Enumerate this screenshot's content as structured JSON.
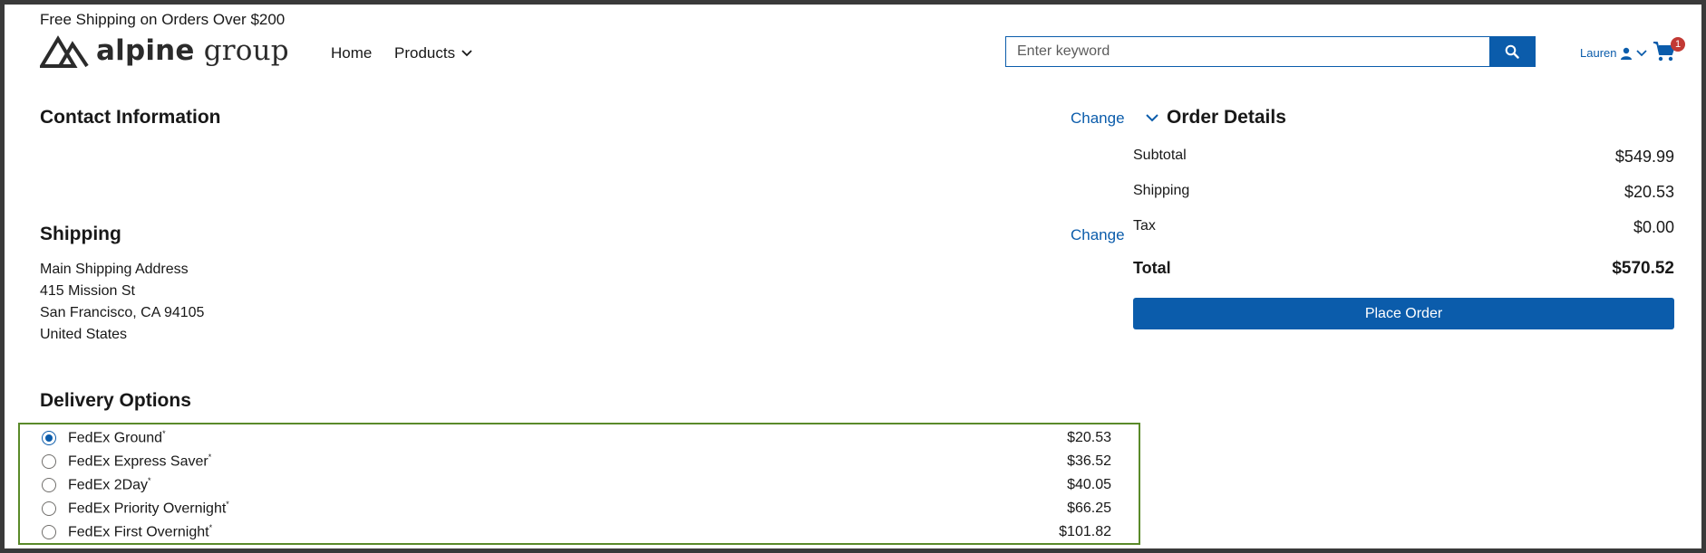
{
  "header": {
    "promo": "Free Shipping on Orders Over $200",
    "logo": {
      "bold": "alpine",
      "light": " group"
    },
    "nav": {
      "home": "Home",
      "products": "Products"
    },
    "search": {
      "placeholder": "Enter keyword",
      "value": ""
    },
    "user": {
      "name": "Lauren"
    },
    "cart": {
      "count": "1"
    }
  },
  "contact": {
    "title": "Contact Information",
    "change": "Change"
  },
  "shipping": {
    "title": "Shipping",
    "change": "Change",
    "address": [
      "Main Shipping Address",
      "415 Mission St",
      "San Francisco, CA 94105",
      "United States"
    ]
  },
  "delivery": {
    "title": "Delivery Options",
    "selected_index": 0,
    "options": [
      {
        "label": "FedEx Ground",
        "mark": "*",
        "price": "$20.53"
      },
      {
        "label": "FedEx Express Saver",
        "mark": "*",
        "price": "$36.52"
      },
      {
        "label": "FedEx 2Day",
        "mark": "*",
        "price": "$40.05"
      },
      {
        "label": "FedEx Priority Overnight",
        "mark": "*",
        "price": "$66.25"
      },
      {
        "label": "FedEx First Overnight",
        "mark": "*",
        "price": "$101.82"
      }
    ]
  },
  "order": {
    "title": "Order Details",
    "subtotal_label": "Subtotal",
    "subtotal": "$549.99",
    "shipping_label": "Shipping",
    "shipping": "$20.53",
    "tax_label": "Tax",
    "tax": "$0.00",
    "total_label": "Total",
    "total": "$570.52",
    "place_order": "Place Order"
  },
  "colors": {
    "brand": "#0b5cab",
    "highlight_border": "#5a8a2a",
    "badge": "#c23934"
  },
  "icons": {
    "search": "search-icon",
    "user": "user-icon",
    "cart": "cart-icon",
    "chevron": "chevron-down-icon"
  }
}
